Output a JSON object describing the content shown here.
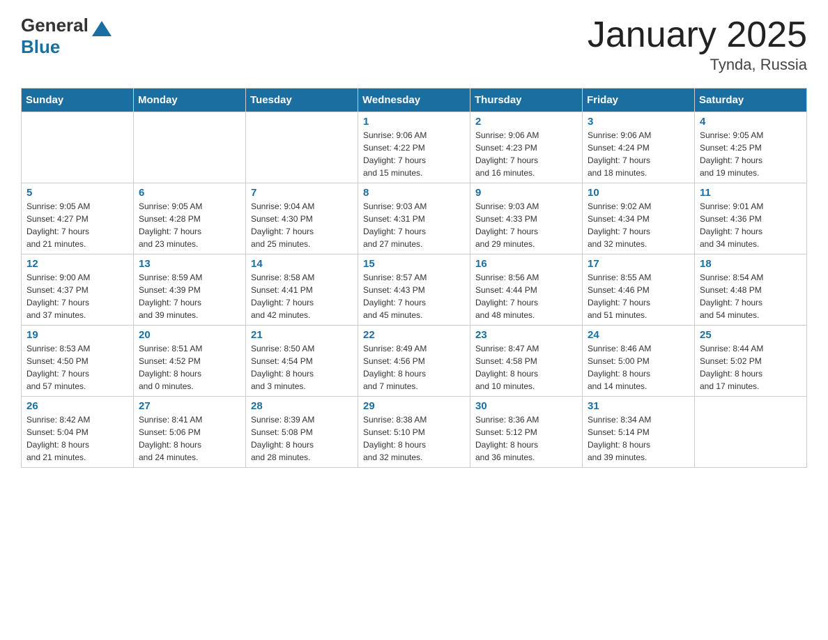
{
  "header": {
    "logo": {
      "general": "General",
      "blue": "Blue"
    },
    "title": "January 2025",
    "subtitle": "Tynda, Russia"
  },
  "days_of_week": [
    "Sunday",
    "Monday",
    "Tuesday",
    "Wednesday",
    "Thursday",
    "Friday",
    "Saturday"
  ],
  "weeks": [
    [
      {
        "day": "",
        "info": ""
      },
      {
        "day": "",
        "info": ""
      },
      {
        "day": "",
        "info": ""
      },
      {
        "day": "1",
        "info": "Sunrise: 9:06 AM\nSunset: 4:22 PM\nDaylight: 7 hours\nand 15 minutes."
      },
      {
        "day": "2",
        "info": "Sunrise: 9:06 AM\nSunset: 4:23 PM\nDaylight: 7 hours\nand 16 minutes."
      },
      {
        "day": "3",
        "info": "Sunrise: 9:06 AM\nSunset: 4:24 PM\nDaylight: 7 hours\nand 18 minutes."
      },
      {
        "day": "4",
        "info": "Sunrise: 9:05 AM\nSunset: 4:25 PM\nDaylight: 7 hours\nand 19 minutes."
      }
    ],
    [
      {
        "day": "5",
        "info": "Sunrise: 9:05 AM\nSunset: 4:27 PM\nDaylight: 7 hours\nand 21 minutes."
      },
      {
        "day": "6",
        "info": "Sunrise: 9:05 AM\nSunset: 4:28 PM\nDaylight: 7 hours\nand 23 minutes."
      },
      {
        "day": "7",
        "info": "Sunrise: 9:04 AM\nSunset: 4:30 PM\nDaylight: 7 hours\nand 25 minutes."
      },
      {
        "day": "8",
        "info": "Sunrise: 9:03 AM\nSunset: 4:31 PM\nDaylight: 7 hours\nand 27 minutes."
      },
      {
        "day": "9",
        "info": "Sunrise: 9:03 AM\nSunset: 4:33 PM\nDaylight: 7 hours\nand 29 minutes."
      },
      {
        "day": "10",
        "info": "Sunrise: 9:02 AM\nSunset: 4:34 PM\nDaylight: 7 hours\nand 32 minutes."
      },
      {
        "day": "11",
        "info": "Sunrise: 9:01 AM\nSunset: 4:36 PM\nDaylight: 7 hours\nand 34 minutes."
      }
    ],
    [
      {
        "day": "12",
        "info": "Sunrise: 9:00 AM\nSunset: 4:37 PM\nDaylight: 7 hours\nand 37 minutes."
      },
      {
        "day": "13",
        "info": "Sunrise: 8:59 AM\nSunset: 4:39 PM\nDaylight: 7 hours\nand 39 minutes."
      },
      {
        "day": "14",
        "info": "Sunrise: 8:58 AM\nSunset: 4:41 PM\nDaylight: 7 hours\nand 42 minutes."
      },
      {
        "day": "15",
        "info": "Sunrise: 8:57 AM\nSunset: 4:43 PM\nDaylight: 7 hours\nand 45 minutes."
      },
      {
        "day": "16",
        "info": "Sunrise: 8:56 AM\nSunset: 4:44 PM\nDaylight: 7 hours\nand 48 minutes."
      },
      {
        "day": "17",
        "info": "Sunrise: 8:55 AM\nSunset: 4:46 PM\nDaylight: 7 hours\nand 51 minutes."
      },
      {
        "day": "18",
        "info": "Sunrise: 8:54 AM\nSunset: 4:48 PM\nDaylight: 7 hours\nand 54 minutes."
      }
    ],
    [
      {
        "day": "19",
        "info": "Sunrise: 8:53 AM\nSunset: 4:50 PM\nDaylight: 7 hours\nand 57 minutes."
      },
      {
        "day": "20",
        "info": "Sunrise: 8:51 AM\nSunset: 4:52 PM\nDaylight: 8 hours\nand 0 minutes."
      },
      {
        "day": "21",
        "info": "Sunrise: 8:50 AM\nSunset: 4:54 PM\nDaylight: 8 hours\nand 3 minutes."
      },
      {
        "day": "22",
        "info": "Sunrise: 8:49 AM\nSunset: 4:56 PM\nDaylight: 8 hours\nand 7 minutes."
      },
      {
        "day": "23",
        "info": "Sunrise: 8:47 AM\nSunset: 4:58 PM\nDaylight: 8 hours\nand 10 minutes."
      },
      {
        "day": "24",
        "info": "Sunrise: 8:46 AM\nSunset: 5:00 PM\nDaylight: 8 hours\nand 14 minutes."
      },
      {
        "day": "25",
        "info": "Sunrise: 8:44 AM\nSunset: 5:02 PM\nDaylight: 8 hours\nand 17 minutes."
      }
    ],
    [
      {
        "day": "26",
        "info": "Sunrise: 8:42 AM\nSunset: 5:04 PM\nDaylight: 8 hours\nand 21 minutes."
      },
      {
        "day": "27",
        "info": "Sunrise: 8:41 AM\nSunset: 5:06 PM\nDaylight: 8 hours\nand 24 minutes."
      },
      {
        "day": "28",
        "info": "Sunrise: 8:39 AM\nSunset: 5:08 PM\nDaylight: 8 hours\nand 28 minutes."
      },
      {
        "day": "29",
        "info": "Sunrise: 8:38 AM\nSunset: 5:10 PM\nDaylight: 8 hours\nand 32 minutes."
      },
      {
        "day": "30",
        "info": "Sunrise: 8:36 AM\nSunset: 5:12 PM\nDaylight: 8 hours\nand 36 minutes."
      },
      {
        "day": "31",
        "info": "Sunrise: 8:34 AM\nSunset: 5:14 PM\nDaylight: 8 hours\nand 39 minutes."
      },
      {
        "day": "",
        "info": ""
      }
    ]
  ]
}
